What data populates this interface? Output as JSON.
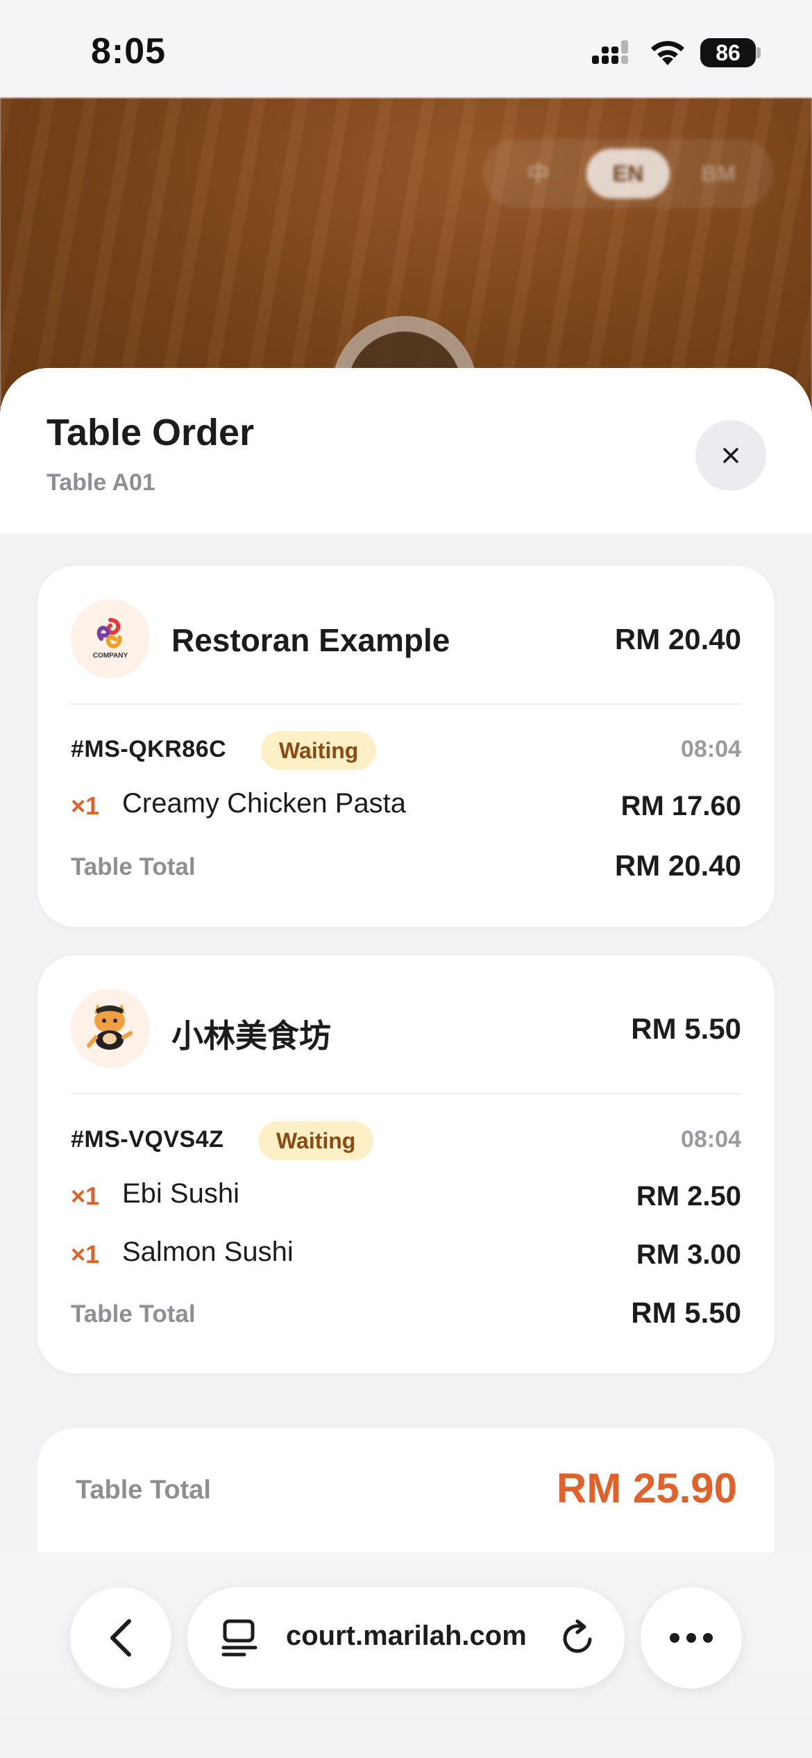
{
  "status_bar": {
    "time": "8:05",
    "battery": "86"
  },
  "language_switch": {
    "options": [
      "中",
      "EN",
      "BM"
    ],
    "active": "EN"
  },
  "sheet": {
    "title": "Table Order",
    "subtitle": "Table A01"
  },
  "stores": [
    {
      "name": "Restoran Example",
      "total": "RM 20.40",
      "logo_text": "COMPANY",
      "order_id": "#MS-QKR86C",
      "status": "Waiting",
      "time": "08:04",
      "items": [
        {
          "qty": "×1",
          "name": "Creamy Chicken Pasta",
          "price": "RM 17.60"
        }
      ],
      "subtotal_label": "Table Total",
      "subtotal_value": "RM 20.40"
    },
    {
      "name": "小林美食坊",
      "total": "RM 5.50",
      "order_id": "#MS-VQVS4Z",
      "status": "Waiting",
      "time": "08:04",
      "items": [
        {
          "qty": "×1",
          "name": "Ebi Sushi",
          "price": "RM 2.50"
        },
        {
          "qty": "×1",
          "name": "Salmon Sushi",
          "price": "RM 3.00"
        }
      ],
      "subtotal_label": "Table Total",
      "subtotal_value": "RM 5.50"
    }
  ],
  "grand_total": {
    "label": "Table Total",
    "value": "RM 25.90"
  },
  "browser": {
    "url": "court.marilah.com"
  },
  "colors": {
    "accent": "#e0622a",
    "badge_bg": "#fdf0c7",
    "badge_text": "#8a4a12"
  }
}
